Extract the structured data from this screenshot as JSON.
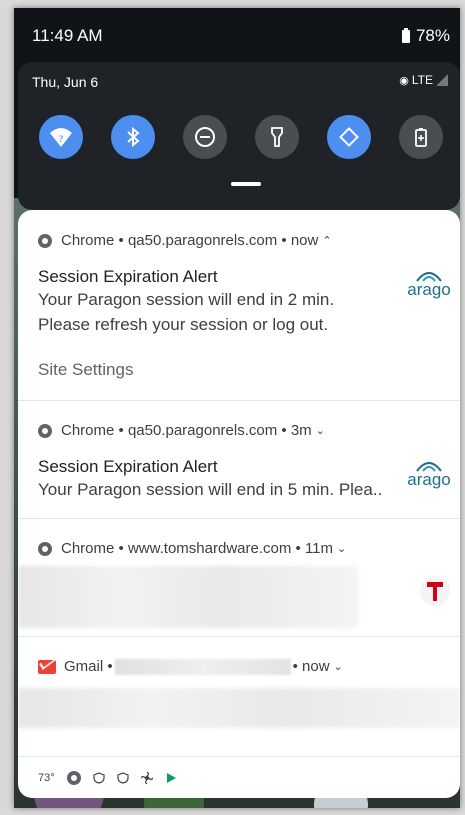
{
  "status_bar": {
    "time": "11:49 AM",
    "battery": "78%"
  },
  "quick_settings": {
    "date": "Thu, Jun 6",
    "network": "LTE",
    "tiles": [
      {
        "icon": "wifi-icon",
        "on": true
      },
      {
        "icon": "bluetooth-icon",
        "on": true
      },
      {
        "icon": "do-not-disturb-icon",
        "on": false
      },
      {
        "icon": "flashlight-icon",
        "on": false
      },
      {
        "icon": "auto-rotate-icon",
        "on": true
      },
      {
        "icon": "battery-saver-icon",
        "on": false
      }
    ]
  },
  "notifications": [
    {
      "app": "Chrome",
      "source": "qa50.paragonrels.com",
      "time": "now",
      "expanded": true,
      "title": "Session Expiration Alert",
      "body_line1": "Your Paragon session will end in 2 min.",
      "body_line2": "Please refresh your session or log out.",
      "action": "Site Settings",
      "logo_text": "arago"
    },
    {
      "app": "Chrome",
      "source": "qa50.paragonrels.com",
      "time": "3m",
      "expanded": false,
      "title": "Session Expiration Alert",
      "body_line1": "Your Paragon session will end in 5 min. Plea..",
      "logo_text": "arago"
    },
    {
      "app": "Chrome",
      "source": "www.tomshardware.com",
      "time": "11m",
      "expanded": false
    },
    {
      "app": "Gmail",
      "time": "now",
      "expanded": false
    }
  ],
  "tray": {
    "temperature": "73°"
  },
  "colors": {
    "accent": "#4d8ff1",
    "panel": "#1f2327",
    "gmail": "#ea4335",
    "tomshardware": "#d0021b"
  }
}
